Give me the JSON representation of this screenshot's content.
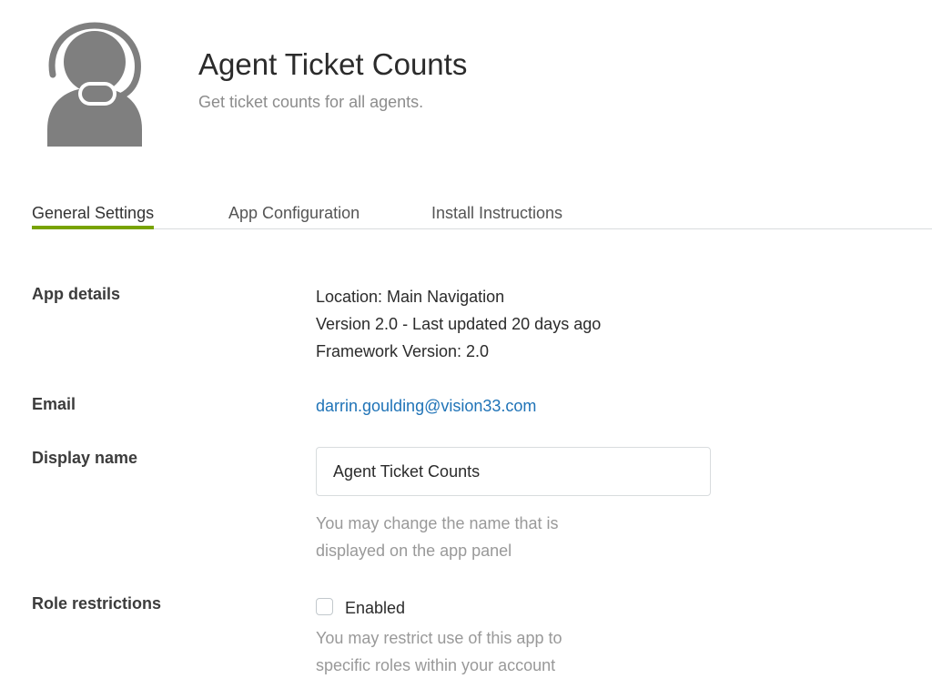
{
  "app": {
    "icon": "agent-headset-icon",
    "title": "Agent Ticket Counts",
    "subtitle": "Get ticket counts for all agents."
  },
  "tabs": [
    {
      "label": "General Settings",
      "active": true
    },
    {
      "label": "App Configuration",
      "active": false
    },
    {
      "label": "Install Instructions",
      "active": false
    }
  ],
  "colors": {
    "active_tab_underline": "#78a300",
    "link": "#1f73b7",
    "icon": "#7f7f7f",
    "hint_text": "#999999"
  },
  "settings": {
    "app_details": {
      "label": "App details",
      "lines": [
        "Location: Main Navigation",
        "Version 2.0 - Last updated 20 days ago",
        "Framework Version: 2.0"
      ]
    },
    "email": {
      "label": "Email",
      "value": "darrin.goulding@vision33.com"
    },
    "display_name": {
      "label": "Display name",
      "value": "Agent Ticket Counts",
      "hint_lines": [
        "You may change the name that is",
        "displayed on the app panel"
      ]
    },
    "role_restrictions": {
      "label": "Role restrictions",
      "checkbox_label": "Enabled",
      "checked": false,
      "hint_lines": [
        "You may restrict use of this app to",
        "specific roles within your account"
      ]
    }
  }
}
